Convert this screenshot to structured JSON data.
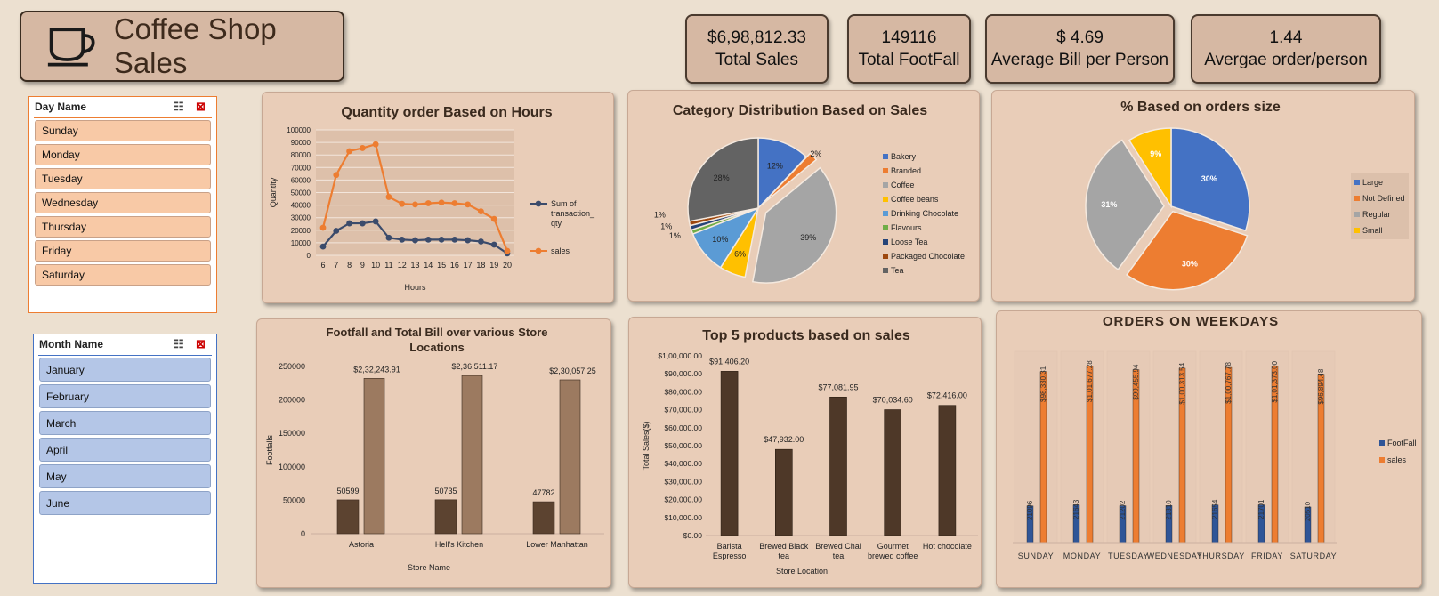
{
  "header": {
    "title": "Coffee Shop Sales",
    "icon": "coffee-cup-icon"
  },
  "kpis": [
    {
      "value": "$6,98,812.33",
      "label": "Total Sales"
    },
    {
      "value": "149116",
      "label": "Total FootFall"
    },
    {
      "value": "$ 4.69",
      "label": "Average Bill per Person"
    },
    {
      "value": "1.44",
      "label": "Avergae order/person"
    }
  ],
  "day_slicer": {
    "title": "Day Name",
    "items": [
      "Sunday",
      "Monday",
      "Tuesday",
      "Wednesday",
      "Thursday",
      "Friday",
      "Saturday"
    ],
    "item_color": "#f8c9a6"
  },
  "month_slicer": {
    "title": "Month Name",
    "items": [
      "January",
      "February",
      "March",
      "April",
      "May",
      "June"
    ],
    "item_color": "#b4c6e7"
  },
  "chart_data": [
    {
      "id": "hours",
      "type": "line",
      "title": "Quantity order Based on Hours",
      "xlabel": "Hours",
      "ylabel": "Quantity",
      "x": [
        6,
        7,
        8,
        9,
        10,
        11,
        12,
        13,
        14,
        15,
        16,
        17,
        18,
        19,
        20
      ],
      "ylim": [
        0,
        100000
      ],
      "yticks": [
        "0",
        "10000",
        "20000",
        "30000",
        "40000",
        "50000",
        "60000",
        "70000",
        "80000",
        "90000",
        "100000"
      ],
      "series": [
        {
          "name": "Sum of transaction_ qty",
          "color": "#3b4b6b",
          "values": [
            7000,
            19500,
            25500,
            25500,
            27000,
            14000,
            12500,
            12000,
            12500,
            12500,
            12500,
            12000,
            11000,
            8500,
            1500
          ]
        },
        {
          "name": "sales",
          "color": "#ed7d31",
          "values": [
            22000,
            64000,
            83000,
            85500,
            88500,
            46500,
            41000,
            40500,
            41500,
            42000,
            41500,
            40500,
            35000,
            29000,
            3500
          ]
        }
      ],
      "legend": "right"
    },
    {
      "id": "category",
      "type": "pie",
      "title": "Category Distribution Based on Sales",
      "labels": [
        "Bakery",
        "Branded",
        "Coffee",
        "Coffee beans",
        "Drinking Chocolate",
        "Flavours",
        "Loose Tea",
        "Packaged Chocolate",
        "Tea"
      ],
      "values": [
        12,
        2,
        39,
        6,
        10,
        1,
        1,
        1,
        28
      ],
      "value_labels": [
        "12%",
        "2%",
        "39%",
        "6%",
        "10%",
        "1%",
        "1%",
        "1%",
        "28%"
      ],
      "colors": [
        "#4472c4",
        "#ed7d31",
        "#a5a5a5",
        "#ffc000",
        "#5b9bd5",
        "#70ad47",
        "#264478",
        "#9e480e",
        "#636363"
      ],
      "legend": "right"
    },
    {
      "id": "size",
      "type": "pie",
      "title": "% Based on orders size",
      "labels": [
        "Large",
        "Not Defined",
        "Regular",
        "Small"
      ],
      "values": [
        30,
        30,
        31,
        9
      ],
      "value_labels": [
        "30%",
        "30%",
        "31%",
        "9%"
      ],
      "colors": [
        "#4472c4",
        "#ed7d31",
        "#a5a5a5",
        "#ffc000"
      ],
      "legend": "right"
    },
    {
      "id": "stores",
      "type": "bar",
      "title": "Footfall and Total Bill over various Store Locations",
      "xlabel": "Store Name",
      "ylabel": "Footfalls",
      "categories": [
        "Astoria",
        "Hell's Kitchen",
        "Lower Manhattan"
      ],
      "ylim": [
        0,
        250000
      ],
      "yticks": [
        "0",
        "50000",
        "100000",
        "150000",
        "200000",
        "250000"
      ],
      "series": [
        {
          "values": [
            50599,
            50735,
            47782
          ],
          "value_labels": [
            "50599",
            "50735",
            "47782"
          ],
          "color": "#5c4330"
        },
        {
          "values": [
            232243.91,
            236511.17,
            230057.25
          ],
          "value_labels": [
            "$2,32,243.91",
            "$2,36,511.17",
            "$2,30,057.25"
          ],
          "color": "#9c7a60"
        }
      ]
    },
    {
      "id": "products",
      "type": "bar",
      "title": "Top 5 products based on sales",
      "xlabel": "Store Location",
      "ylabel": "Total Sales($)",
      "categories": [
        "Barista Espresso",
        "Brewed Black tea",
        "Brewed Chai tea",
        "Gourmet brewed coffee",
        "Hot chocolate"
      ],
      "category_lines": [
        [
          "Barista",
          "Espresso"
        ],
        [
          "Brewed Black",
          "tea"
        ],
        [
          "Brewed Chai",
          "tea"
        ],
        [
          "Gourmet",
          "brewed coffee"
        ],
        [
          "Hot chocolate"
        ]
      ],
      "values": [
        91406.2,
        47932.0,
        77081.95,
        70034.6,
        72416.0
      ],
      "value_labels": [
        "$91,406.20",
        "$47,932.00",
        "$77,081.95",
        "$70,034.60",
        "$72,416.00"
      ],
      "ylim": [
        0,
        100000
      ],
      "yticks": [
        "$0.00",
        "$10,000.00",
        "$20,000.00",
        "$30,000.00",
        "$40,000.00",
        "$50,000.00",
        "$60,000.00",
        "$70,000.00",
        "$80,000.00",
        "$90,000.00",
        "$1,00,000.00"
      ],
      "color": "#4e3828"
    },
    {
      "id": "weekdays",
      "type": "bar",
      "title": "ORDERS ON WEEKDAYS",
      "categories": [
        "SUNDAY",
        "MONDAY",
        "TUESDAY",
        "WEDNESDAY",
        "THURSDAY",
        "FRIDAY",
        "SATURDAY"
      ],
      "ylim": [
        0,
        110000
      ],
      "series": [
        {
          "name": "FootFall",
          "color": "#2f5597",
          "values": [
            21096,
            21643,
            21202,
            21310,
            21654,
            21701,
            20510
          ],
          "value_labels": [
            "21096",
            "21643",
            "21202",
            "21310",
            "21654",
            "21701",
            "20510"
          ]
        },
        {
          "name": "sales",
          "color": "#ed7d31",
          "values": [
            98330.31,
            101677.28,
            99455.94,
            100313.54,
            100767.78,
            101373.0,
            96894.48
          ],
          "value_labels": [
            "$98,330.31",
            "$1,01,677.28",
            "$99,455.94",
            "$1,00,313.54",
            "$1,00,767.78",
            "$1,01,373.00",
            "$96,894.48"
          ]
        }
      ],
      "legend": "right"
    }
  ]
}
